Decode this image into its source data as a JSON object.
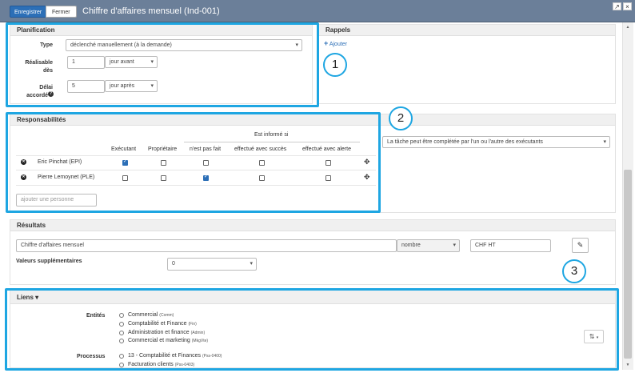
{
  "window": {
    "save_label": "Enregistrer",
    "close_label": "Fermer",
    "title": "Chiffre d'affaires mensuel (Ind-001)",
    "expand_glyph": "↗",
    "close_glyph": "×"
  },
  "planification": {
    "title": "Planification",
    "type_label": "Type",
    "type_value": "déclenché manuellement (à la demande)",
    "realisable_label_1": "Réalisable",
    "realisable_label_2": "dès",
    "realisable_value": "1",
    "realisable_unit": "jour avant",
    "delai_label_1": "Délai",
    "delai_label_2": "accordé",
    "delai_value": "5",
    "delai_unit": "jour après"
  },
  "rappels": {
    "title": "Rappels",
    "add_label": "Ajouter"
  },
  "responsabilites": {
    "title": "Responsabilités",
    "group_header": "Est informé si",
    "columns": [
      "Exécutant",
      "Propriétaire",
      "n'est pas fait",
      "effectué avec succès",
      "effectué avec alerte"
    ],
    "rows": [
      {
        "name": "Eric Pinchat (EPI)",
        "checks": [
          true,
          false,
          false,
          false,
          false
        ]
      },
      {
        "name": "Pierre Lemoynet (PLE)",
        "checks": [
          false,
          false,
          true,
          false,
          false
        ]
      }
    ],
    "add_person_placeholder": "ajouter une personne",
    "completion_value": "La tâche peut être complétée par l'un ou l'autre des exécutants"
  },
  "resultats": {
    "title": "Résultats",
    "name_value": "Chiffre d'affaires mensuel",
    "type_value": "nombre",
    "unit_value": "CHF HT",
    "extra_label": "Valeurs supplémentaires",
    "extra_value": "0"
  },
  "liens": {
    "title": "Liens",
    "entites_label": "Entités",
    "entites": [
      {
        "name": "Commercial",
        "code": "(Comm)"
      },
      {
        "name": "Comptabilité et Finance",
        "code": "(Fin)"
      },
      {
        "name": "Administration et finance",
        "code": "(Admin)"
      },
      {
        "name": "Commercial et marketing",
        "code": "(MkgVte)"
      }
    ],
    "processus_label": "Processus",
    "processus": [
      {
        "name": "13 - Comptabilité et Finances",
        "code": "(Pss-0400)"
      },
      {
        "name": "Facturation clients",
        "code": "(Pss-0403)"
      }
    ],
    "sort_glyph": "⇅"
  },
  "annotations": [
    "1",
    "2",
    "3"
  ],
  "colors": {
    "highlight": "#1ea6e2",
    "titlebar": "#6b7f99",
    "primary": "#2c6fb7"
  }
}
